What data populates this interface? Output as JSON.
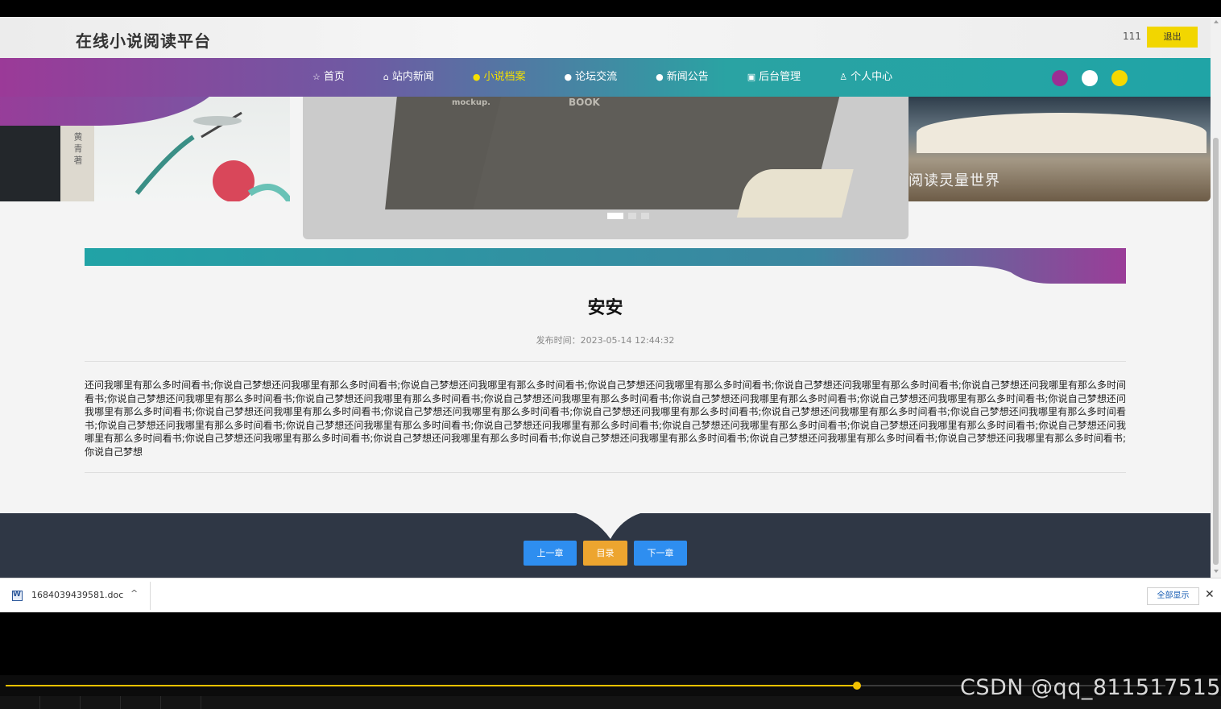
{
  "header": {
    "site_title": "在线小说阅读平台",
    "username": "111",
    "logout_label": "退出"
  },
  "nav": {
    "items": [
      {
        "icon": "☆",
        "label": "首页",
        "active": false
      },
      {
        "icon": "⌂",
        "label": "站内新闻",
        "active": false
      },
      {
        "icon": "●",
        "label": "小说档案",
        "active": true
      },
      {
        "icon": "●",
        "label": "论坛交流",
        "active": false
      },
      {
        "icon": "●",
        "label": "新闻公告",
        "active": false
      },
      {
        "icon": "▣",
        "label": "后台管理",
        "active": false
      },
      {
        "icon": "♙",
        "label": "个人中心",
        "active": false
      }
    ],
    "theme_colors": [
      "#9b2f94",
      "#ffffff",
      "#f5d800"
    ]
  },
  "banner": {
    "left_text": "黄 青 著",
    "center_book_label_1": "mockup.",
    "center_book_label_2": "BOOK",
    "right_text": "阅读灵量世界",
    "active_slide": 1,
    "slide_count": 3
  },
  "article": {
    "title": "安安",
    "publish_time": "发布时间：2023-05-14 12:44:32",
    "body": "还问我哪里有那么多时间看书;你说自己梦想还问我哪里有那么多时间看书;你说自己梦想还问我哪里有那么多时间看书;你说自己梦想还问我哪里有那么多时间看书;你说自己梦想还问我哪里有那么多时间看书;你说自己梦想还问我哪里有那么多时间看书;你说自己梦想还问我哪里有那么多时间看书;你说自己梦想还问我哪里有那么多时间看书;你说自己梦想还问我哪里有那么多时间看书;你说自己梦想还问我哪里有那么多时间看书;你说自己梦想还问我哪里有那么多时间看书;你说自己梦想还问我哪里有那么多时间看书;你说自己梦想还问我哪里有那么多时间看书;你说自己梦想还问我哪里有那么多时间看书;你说自己梦想还问我哪里有那么多时间看书;你说自己梦想还问我哪里有那么多时间看书;你说自己梦想还问我哪里有那么多时间看书;你说自己梦想还问我哪里有那么多时间看书;你说自己梦想还问我哪里有那么多时间看书;你说自己梦想还问我哪里有那么多时间看书;你说自己梦想还问我哪里有那么多时间看书;你说自己梦想还问我哪里有那么多时间看书;你说自己梦想还问我哪里有那么多时间看书;你说自己梦想还问我哪里有那么多时间看书;你说自己梦想还问我哪里有那么多时间看书;你说自己梦想还问我哪里有那么多时间看书;你说自己梦想还问我哪里有那么多时间看书;你说自己梦想还问我哪里有那么多时间看书;你说自己梦想"
  },
  "footer": {
    "prev_label": "上一章",
    "toc_label": "目录",
    "next_label": "下一章"
  },
  "downloads": {
    "file_name": "1684039439581.doc",
    "show_all_label": "全部显示",
    "close_symbol": "✕",
    "chevron": "^"
  },
  "player": {
    "progress_fraction": 0.733,
    "watermark": "CSDN @qq_811517515"
  },
  "icons": [
    "star-icon",
    "home-icon",
    "dot-icon",
    "building-icon",
    "person-icon",
    "word-doc-icon",
    "chevron-up-icon",
    "close-icon"
  ]
}
